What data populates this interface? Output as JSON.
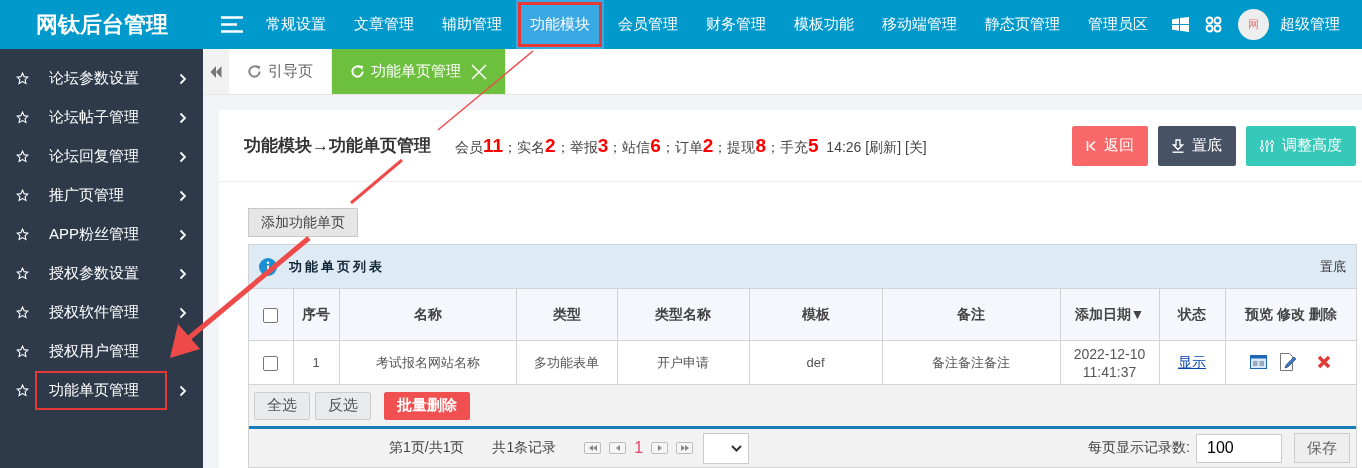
{
  "app": {
    "title": "网钛后台管理"
  },
  "top_nav": [
    {
      "label": "常规设置",
      "selected": false,
      "highlighted": false
    },
    {
      "label": "文章管理",
      "selected": false,
      "highlighted": false
    },
    {
      "label": "辅助管理",
      "selected": false,
      "highlighted": false
    },
    {
      "label": "功能模块",
      "selected": true,
      "highlighted": true
    },
    {
      "label": "会员管理",
      "selected": false,
      "highlighted": false
    },
    {
      "label": "财务管理",
      "selected": false,
      "highlighted": false
    },
    {
      "label": "模板功能",
      "selected": false,
      "highlighted": false
    },
    {
      "label": "移动端管理",
      "selected": false,
      "highlighted": false
    },
    {
      "label": "静态页管理",
      "selected": false,
      "highlighted": false
    },
    {
      "label": "管理员区",
      "selected": false,
      "highlighted": false
    }
  ],
  "user": {
    "avatar_char": "网",
    "name": "超级管理"
  },
  "sidebar": [
    {
      "label": "论坛参数设置",
      "has_submenu": true,
      "highlighted": false
    },
    {
      "label": "论坛帖子管理",
      "has_submenu": true,
      "highlighted": false
    },
    {
      "label": "论坛回复管理",
      "has_submenu": true,
      "highlighted": false
    },
    {
      "label": "推广页管理",
      "has_submenu": true,
      "highlighted": false
    },
    {
      "label": "APP粉丝管理",
      "has_submenu": true,
      "highlighted": false
    },
    {
      "label": "授权参数设置",
      "has_submenu": true,
      "highlighted": false
    },
    {
      "label": "授权软件管理",
      "has_submenu": true,
      "highlighted": false
    },
    {
      "label": "授权用户管理",
      "has_submenu": false,
      "highlighted": false
    },
    {
      "label": "功能单页管理",
      "has_submenu": true,
      "highlighted": true
    }
  ],
  "tabs": [
    {
      "label": "引导页",
      "selected": false,
      "closable": false
    },
    {
      "label": "功能单页管理",
      "selected": true,
      "closable": true
    }
  ],
  "page": {
    "breadcrumb": "功能模块→功能单页管理",
    "stats": [
      {
        "label": "会员",
        "count": "11",
        "sep": "；"
      },
      {
        "label": "实名",
        "count": "2",
        "sep": "；"
      },
      {
        "label": "举报",
        "count": "3",
        "sep": "；"
      },
      {
        "label": "站信",
        "count": "6",
        "sep": "；"
      },
      {
        "label": "订单",
        "count": "2",
        "sep": "；"
      },
      {
        "label": "提现",
        "count": "8",
        "sep": "；"
      },
      {
        "label": "手充",
        "count": "5"
      }
    ],
    "time": "14:26",
    "refresh": "[刷新]",
    "close": "[关]",
    "buttons": [
      {
        "kind": "back",
        "label": "返回"
      },
      {
        "kind": "bottom",
        "label": "置底"
      },
      {
        "kind": "height",
        "label": "调整高度"
      }
    ]
  },
  "add_button": "添加功能单页",
  "table": {
    "title": "功能单页列表",
    "title_link": "置底",
    "select_all_checked": false,
    "columns": [
      "序号",
      "名称",
      "类型",
      "类型名称",
      "模板",
      "备注",
      "添加日期▼",
      "状态",
      "预览 修改 删除"
    ],
    "rows": [
      {
        "checked": false,
        "cells": [
          "1",
          "考试报名网站名称",
          "多功能表单",
          "开户申请",
          "def",
          "备注备注备注",
          "2022-12-10 11:41:37"
        ],
        "status": "显示"
      }
    ]
  },
  "bulk_buttons": [
    {
      "kind": "plain",
      "label": "全选"
    },
    {
      "kind": "plain",
      "label": "反选"
    },
    {
      "kind": "danger",
      "label": "批量删除"
    }
  ],
  "pager": {
    "page_info": "第1页/共1页",
    "records": "共1条记录",
    "current": "1",
    "per_page_label": "每页显示记录数:",
    "per_page": "100",
    "save": "保存"
  }
}
